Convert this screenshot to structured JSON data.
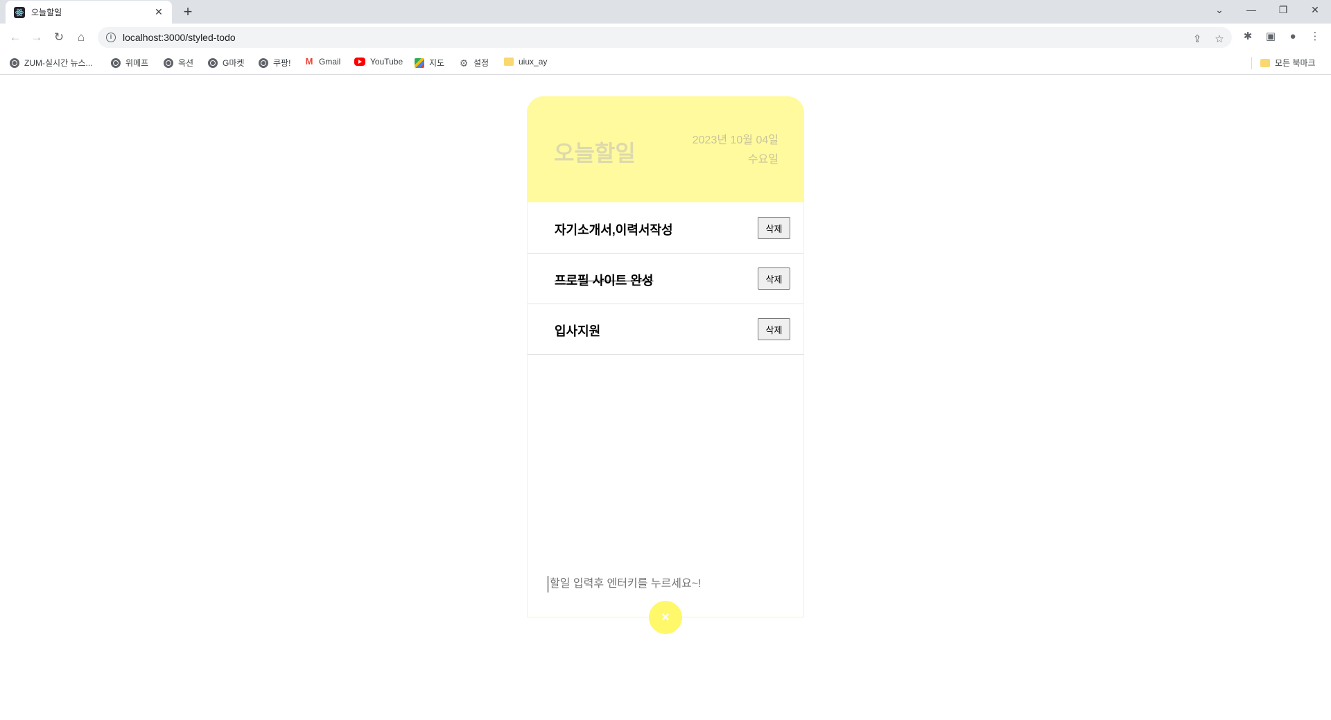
{
  "browser": {
    "tab_title": "오늘할일",
    "new_tab_label": "+",
    "url": "localhost:3000/styled-todo",
    "bookmarks": [
      {
        "label": "ZUM-실시간 뉴스...",
        "icon": "globe-icon"
      },
      {
        "label": "위메프",
        "icon": "globe-icon"
      },
      {
        "label": "옥션",
        "icon": "globe-icon"
      },
      {
        "label": "G마켓",
        "icon": "globe-icon"
      },
      {
        "label": "쿠팡!",
        "icon": "globe-icon"
      },
      {
        "label": "Gmail",
        "icon": "gmail-icon"
      },
      {
        "label": "YouTube",
        "icon": "youtube-icon"
      },
      {
        "label": "지도",
        "icon": "maps-icon"
      },
      {
        "label": "설정",
        "icon": "gear-icon"
      },
      {
        "label": "uiux_ay",
        "icon": "folder-icon"
      }
    ],
    "all_bookmarks": "모든 북마크"
  },
  "todo": {
    "title": "오늘할일",
    "date_line1": "2023년 10월 04일",
    "date_line2": "수요일",
    "items": [
      {
        "text": "자기소개서,이력서작성",
        "done": false,
        "delete_label": "삭제"
      },
      {
        "text": "프로필 사이트 완성",
        "done": true,
        "delete_label": "삭제"
      },
      {
        "text": "입사지원",
        "done": false,
        "delete_label": "삭제"
      }
    ],
    "input_placeholder": "할일 입력후 엔터키를 누르세요~!",
    "fab_label": "×"
  },
  "colors": {
    "header_bg": "#fffa9e",
    "fab_bg": "#fff86a"
  }
}
